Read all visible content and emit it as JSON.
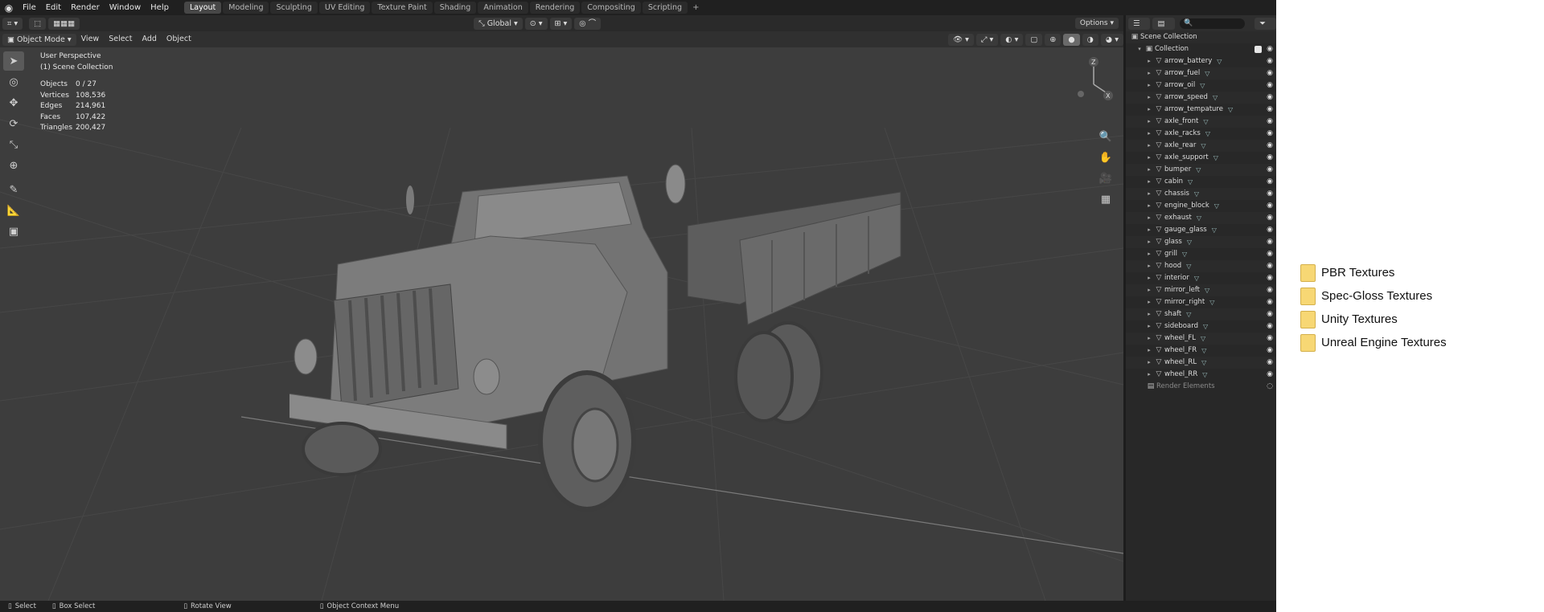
{
  "topbar": {
    "menu": [
      "File",
      "Edit",
      "Render",
      "Window",
      "Help"
    ],
    "workspaces": [
      "Layout",
      "Modeling",
      "Sculpting",
      "UV Editing",
      "Texture Paint",
      "Shading",
      "Animation",
      "Rendering",
      "Compositing",
      "Scripting"
    ],
    "active_workspace": "Layout",
    "add_symbol": "+"
  },
  "toolrow": {
    "orientation": "Global",
    "options_label": "Options"
  },
  "viewport_header": {
    "mode": "Object Mode",
    "menus": [
      "View",
      "Select",
      "Add",
      "Object"
    ]
  },
  "overlay": {
    "view_name": "User Perspective",
    "collection": "(1) Scene Collection",
    "stats": [
      {
        "key": "Objects",
        "value": "0 / 27"
      },
      {
        "key": "Vertices",
        "value": "108,536"
      },
      {
        "key": "Edges",
        "value": "214,961"
      },
      {
        "key": "Faces",
        "value": "107,422"
      },
      {
        "key": "Triangles",
        "value": "200,427"
      }
    ]
  },
  "gizmo": {
    "z": "Z",
    "x": "X"
  },
  "outliner": {
    "scene_collection": "Scene Collection",
    "collection": "Collection",
    "objects": [
      "arrow_battery",
      "arrow_fuel",
      "arrow_oil",
      "arrow_speed",
      "arrow_tempature",
      "axle_front",
      "axle_racks",
      "axle_rear",
      "axle_support",
      "bumper",
      "cabin",
      "chassis",
      "engine_block",
      "exhaust",
      "gauge_glass",
      "glass",
      "grill",
      "hood",
      "interior",
      "mirror_left",
      "mirror_right",
      "shaft",
      "sideboard",
      "wheel_FL",
      "wheel_FR",
      "wheel_RL",
      "wheel_RR"
    ],
    "render_elements": "Render Elements"
  },
  "statusbar": {
    "items": [
      "Select",
      "Box Select",
      "Rotate View",
      "Object Context Menu"
    ]
  },
  "folders": [
    "PBR Textures",
    "Spec-Gloss Textures",
    "Unity Textures",
    "Unreal Engine Textures"
  ]
}
